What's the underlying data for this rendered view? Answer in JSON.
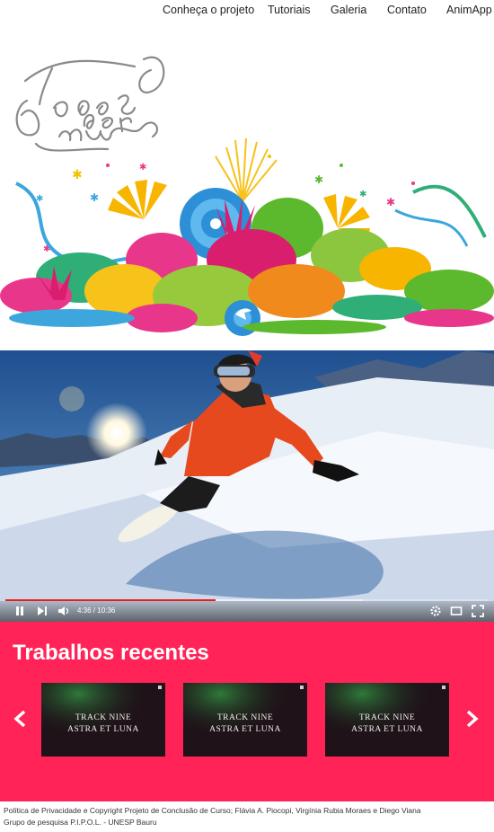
{
  "nav": {
    "items": [
      "Conheça o projeto",
      "Tutoriais",
      "Galeria",
      "Contato",
      "AnimApp"
    ]
  },
  "hero": {
    "logo_text": "Todos por um"
  },
  "video": {
    "time": "4:36 / 10:36",
    "progress": 0.435,
    "buffered": 0.74,
    "controls": {
      "play": "pause-icon",
      "next": "next-icon",
      "volume": "volume-icon",
      "settings": "gear-icon",
      "theater": "theater-icon",
      "fullscreen": "fullscreen-icon"
    }
  },
  "recent": {
    "title": "Trabalhos recentes",
    "items": [
      {
        "line1": "TRACK NINE",
        "line2": "ASTRA ET LUNA"
      },
      {
        "line1": "TRACK NINE",
        "line2": "ASTRA ET LUNA"
      },
      {
        "line1": "TRACK NINE",
        "line2": "ASTRA ET LUNA"
      }
    ]
  },
  "footer": {
    "line1": "Política de Privacidade e Copyright  Projeto de Conclusão de Curso; Flávia A. Piocopi, Virgínia Rubia Moraes e Diego Viana",
    "line2": "Grupo de pesquisa P.I.P.O.L. - UNESP Bauru"
  },
  "colors": {
    "accent_pink": "#ff2357",
    "progress_red": "#e62117"
  }
}
